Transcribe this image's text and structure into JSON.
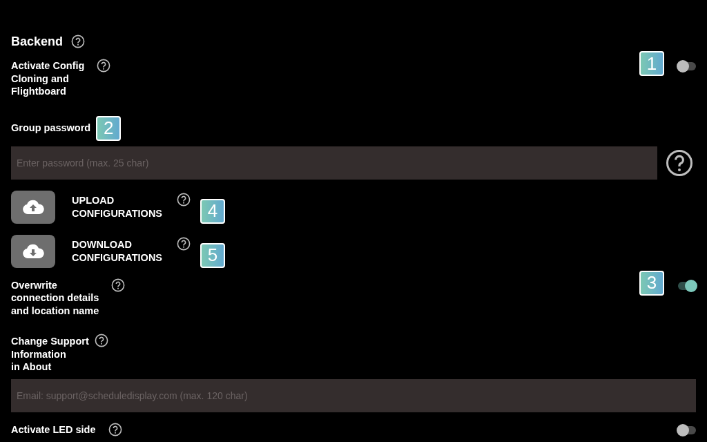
{
  "section": {
    "title": "Backend"
  },
  "items": [
    {
      "kind": "toggle",
      "label": "Activate Config\nCloning and\nFlightboard",
      "on": false,
      "badge": "1"
    },
    {
      "kind": "label",
      "label": "Group password",
      "badge": "2"
    },
    {
      "kind": "input",
      "placeholder": "Enter password (max. 25 char)",
      "help": true
    },
    {
      "kind": "upload",
      "label": "UPLOAD\nCONFIGURATIONS",
      "badge": "4"
    },
    {
      "kind": "download",
      "label": "DOWNLOAD\nCONFIGURATIONS",
      "badge": "5"
    },
    {
      "kind": "toggle",
      "label": "Overwrite\nconnection details\nand location name",
      "on": true,
      "badge": "3"
    },
    {
      "kind": "label",
      "label": "Change Support\nInformation\nin About",
      "help": true
    },
    {
      "kind": "input",
      "placeholder": "Email: support@scheduledisplay.com (max. 120 char)",
      "help": false
    },
    {
      "kind": "toggle",
      "label": "Activate LED side",
      "on": false
    }
  ]
}
